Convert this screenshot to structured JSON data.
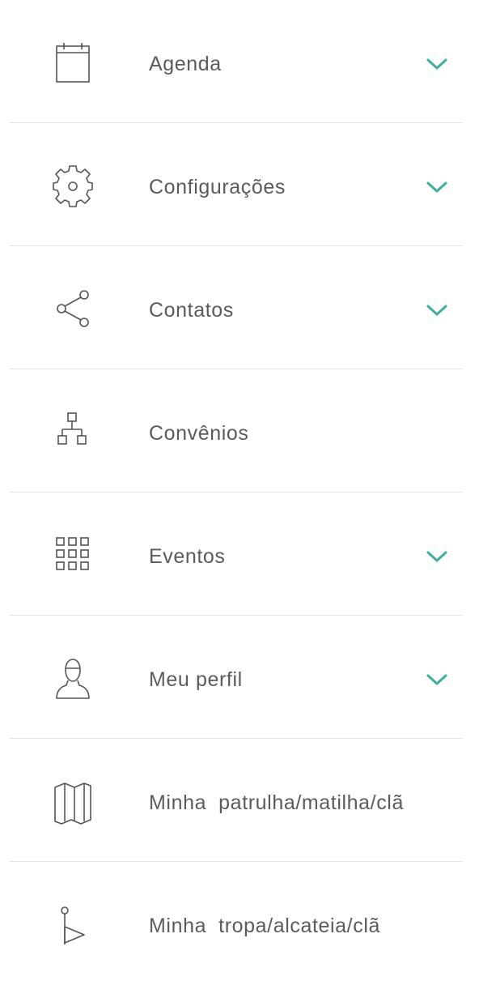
{
  "colors": {
    "text": "#5b5b5b",
    "icon": "#555555",
    "accent": "#3fae9f",
    "divider": "#e3e3e3",
    "background": "#ffffff"
  },
  "menu": {
    "items": [
      {
        "label": "Agenda",
        "icon": "calendar-icon",
        "expandable": true
      },
      {
        "label": "Configurações",
        "icon": "gear-icon",
        "expandable": true
      },
      {
        "label": "Contatos",
        "icon": "share-icon",
        "expandable": true
      },
      {
        "label": "Convênios",
        "icon": "org-chart-icon",
        "expandable": false
      },
      {
        "label": "Eventos",
        "icon": "grid-icon",
        "expandable": true
      },
      {
        "label": "Meu perfil",
        "icon": "user-icon",
        "expandable": true
      },
      {
        "label": "Minha  patrulha/matilha/clã",
        "icon": "map-icon",
        "expandable": false
      },
      {
        "label": "Minha  tropa/alcateia/clã",
        "icon": "flag-icon",
        "expandable": false
      }
    ]
  }
}
